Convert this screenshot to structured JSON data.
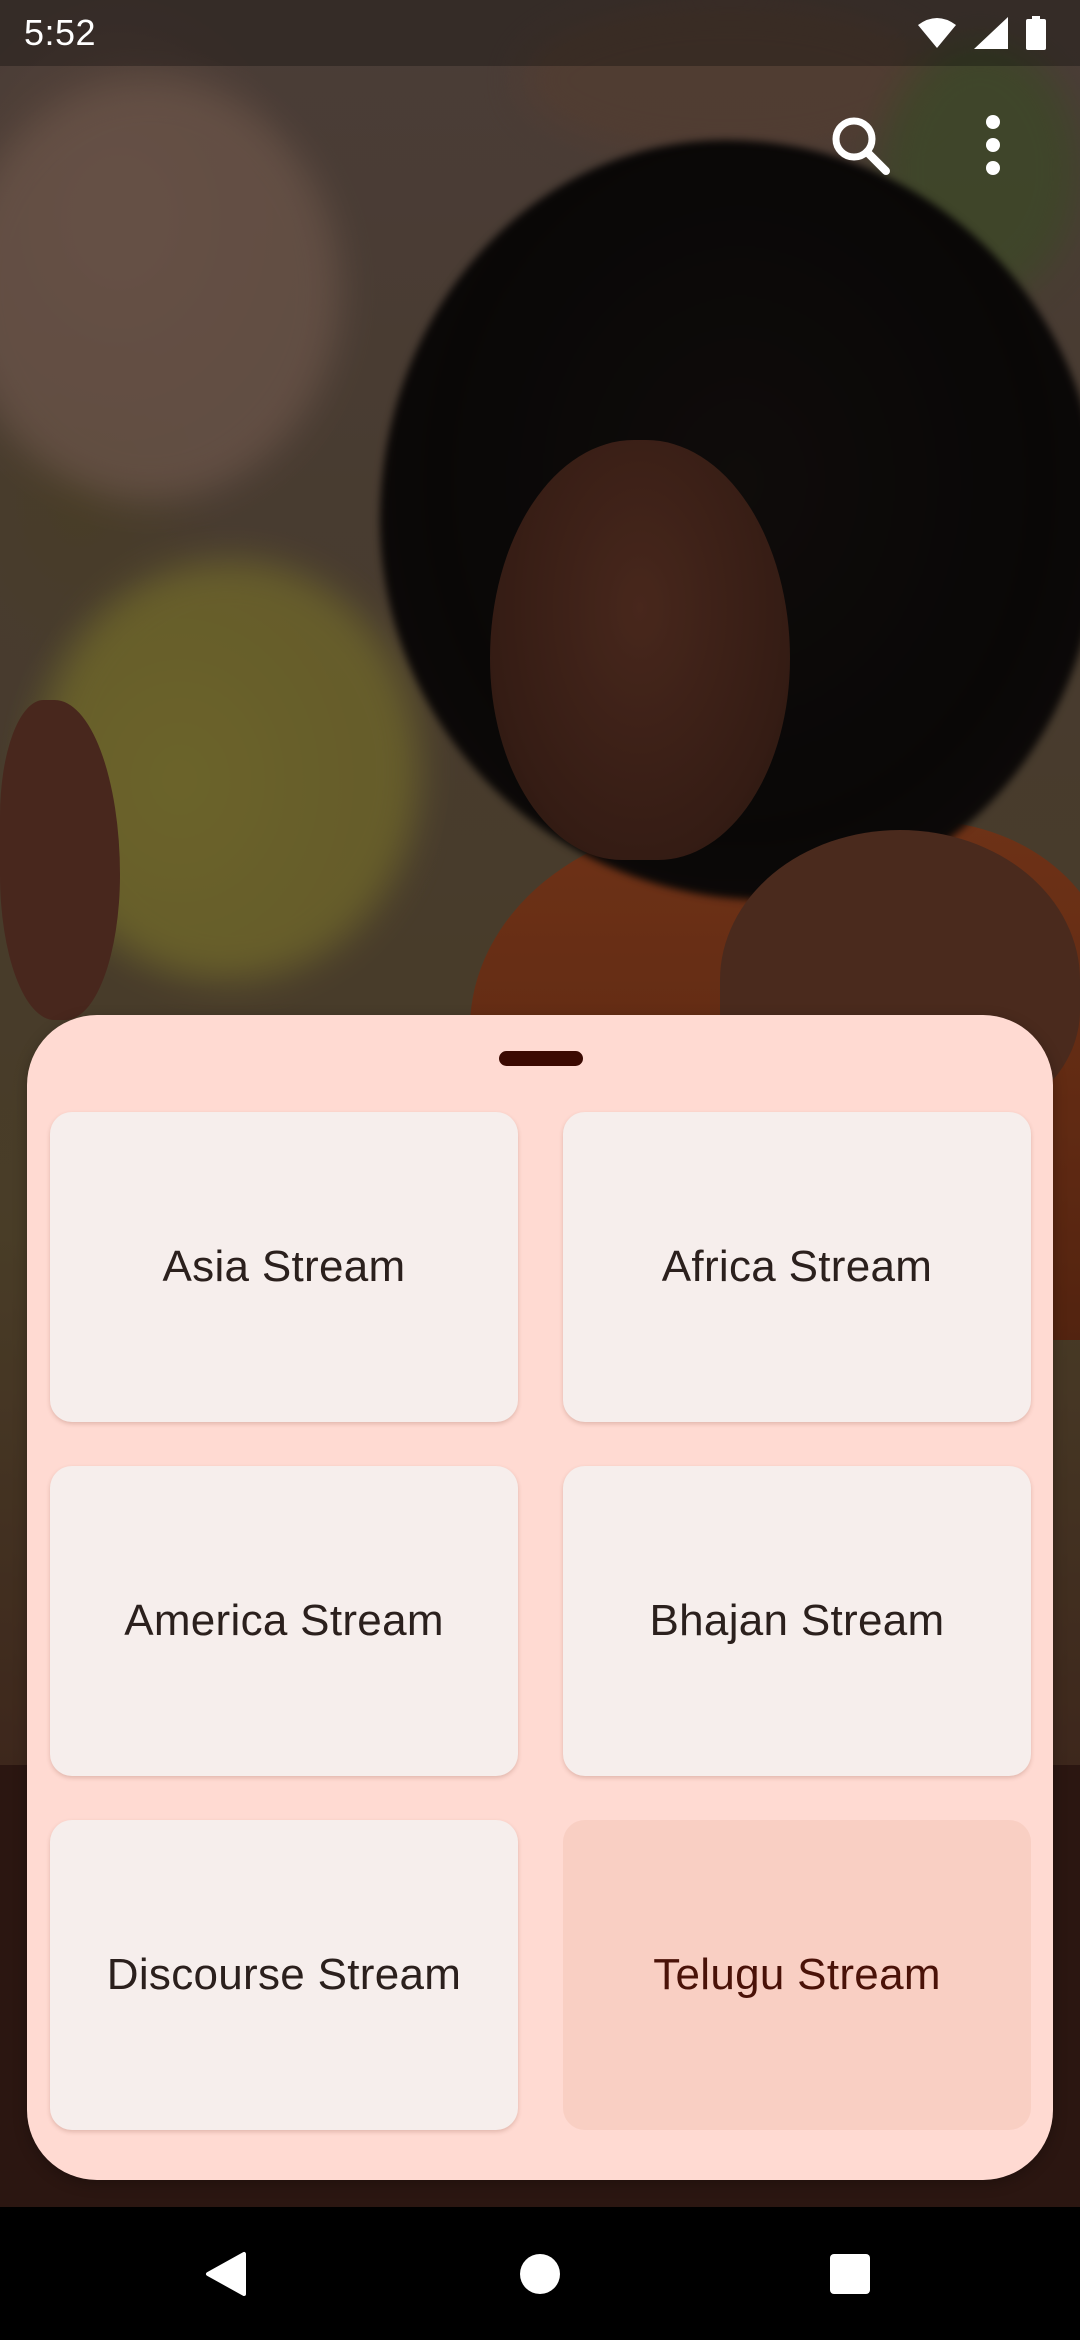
{
  "status_bar": {
    "time": "5:52",
    "icons": [
      "wifi-icon",
      "signal-icon",
      "battery-icon"
    ]
  },
  "app_bar": {
    "actions": [
      "search-icon",
      "more-vert-icon"
    ]
  },
  "sheet": {
    "streams": [
      {
        "label": "Asia Stream",
        "selected": false
      },
      {
        "label": "Africa Stream",
        "selected": false
      },
      {
        "label": "America Stream",
        "selected": false
      },
      {
        "label": "Bhajan Stream",
        "selected": false
      },
      {
        "label": "Discourse Stream",
        "selected": false
      },
      {
        "label": "Telugu Stream",
        "selected": true
      }
    ]
  },
  "nav_bar": {
    "buttons": [
      "back-icon",
      "home-icon",
      "recents-icon"
    ]
  },
  "colors": {
    "sheet_background": "#ffdad2",
    "card_background": "#f6eeec",
    "selected_card_background": "#f9cfc3",
    "drag_handle": "#3b0a02"
  }
}
